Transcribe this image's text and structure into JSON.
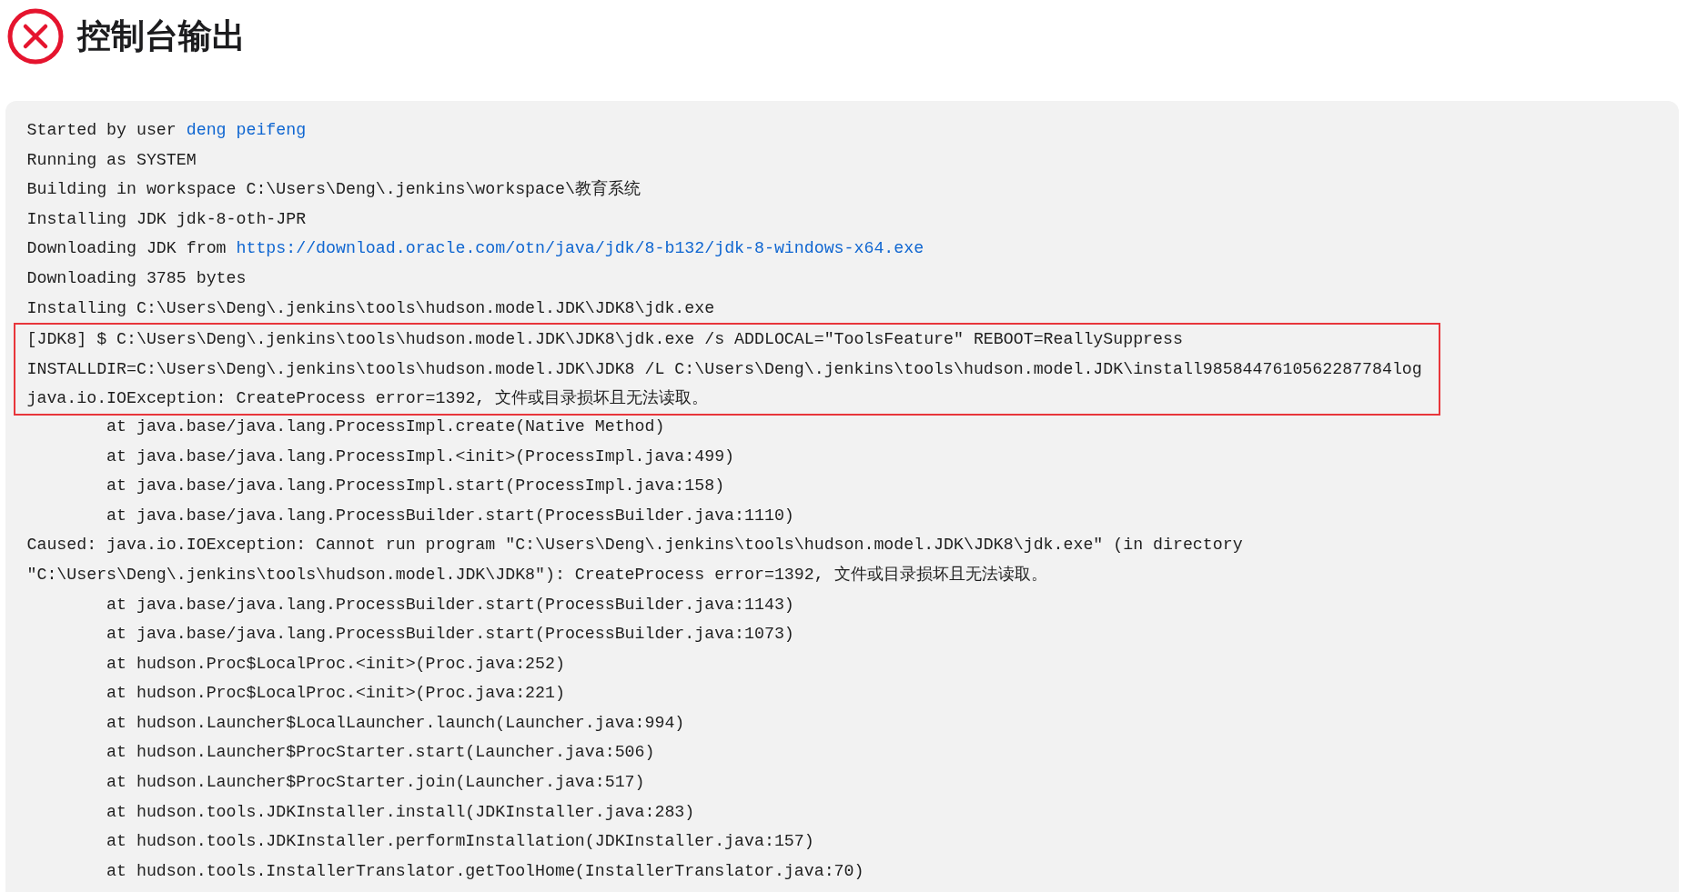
{
  "header": {
    "title": "控制台输出"
  },
  "log": {
    "sections": [
      {
        "highlighted": false,
        "lines": [
          {
            "kind": "message",
            "text": "Started by user ",
            "link": "deng peifeng"
          },
          {
            "kind": "message",
            "text": "Running as SYSTEM"
          },
          {
            "kind": "message",
            "text": "Building in workspace C:\\Users\\Deng\\.jenkins\\workspace\\教育系统"
          },
          {
            "kind": "message",
            "text": "Installing JDK jdk-8-oth-JPR"
          },
          {
            "kind": "message",
            "text": "Downloading JDK from ",
            "link": "https://download.oracle.com/otn/java/jdk/8-b132/jdk-8-windows-x64.exe"
          },
          {
            "kind": "message",
            "text": "Downloading 3785 bytes"
          },
          {
            "kind": "message",
            "text": "Installing C:\\Users\\Deng\\.jenkins\\tools\\hudson.model.JDK\\JDK8\\jdk.exe"
          }
        ]
      },
      {
        "highlighted": true,
        "lines": [
          {
            "kind": "message",
            "text": "[JDK8] $ C:\\Users\\Deng\\.jenkins\\tools\\hudson.model.JDK\\JDK8\\jdk.exe /s ADDLOCAL=\"ToolsFeature\" REBOOT=ReallySuppress"
          },
          {
            "kind": "message",
            "text": "INSTALLDIR=C:\\Users\\Deng\\.jenkins\\tools\\hudson.model.JDK\\JDK8 /L C:\\Users\\Deng\\.jenkins\\tools\\hudson.model.JDK\\install9858447610562287784log"
          },
          {
            "kind": "message",
            "text": "java.io.IOException: CreateProcess error=1392, 文件或目录损坏且无法读取。"
          }
        ]
      },
      {
        "highlighted": false,
        "lines": [
          {
            "kind": "frame",
            "text": "at java.base/java.lang.ProcessImpl.create(Native Method)"
          },
          {
            "kind": "frame",
            "text": "at java.base/java.lang.ProcessImpl.<init>(ProcessImpl.java:499)"
          },
          {
            "kind": "frame",
            "text": "at java.base/java.lang.ProcessImpl.start(ProcessImpl.java:158)"
          },
          {
            "kind": "frame",
            "text": "at java.base/java.lang.ProcessBuilder.start(ProcessBuilder.java:1110)"
          },
          {
            "kind": "message",
            "text": "Caused: java.io.IOException: Cannot run program \"C:\\Users\\Deng\\.jenkins\\tools\\hudson.model.JDK\\JDK8\\jdk.exe\" (in directory"
          },
          {
            "kind": "message",
            "text": "\"C:\\Users\\Deng\\.jenkins\\tools\\hudson.model.JDK\\JDK8\"): CreateProcess error=1392, 文件或目录损坏且无法读取。"
          },
          {
            "kind": "frame",
            "text": "at java.base/java.lang.ProcessBuilder.start(ProcessBuilder.java:1143)"
          },
          {
            "kind": "frame",
            "text": "at java.base/java.lang.ProcessBuilder.start(ProcessBuilder.java:1073)"
          },
          {
            "kind": "frame",
            "text": "at hudson.Proc$LocalProc.<init>(Proc.java:252)"
          },
          {
            "kind": "frame",
            "text": "at hudson.Proc$LocalProc.<init>(Proc.java:221)"
          },
          {
            "kind": "frame",
            "text": "at hudson.Launcher$LocalLauncher.launch(Launcher.java:994)"
          },
          {
            "kind": "frame",
            "text": "at hudson.Launcher$ProcStarter.start(Launcher.java:506)"
          },
          {
            "kind": "frame",
            "text": "at hudson.Launcher$ProcStarter.join(Launcher.java:517)"
          },
          {
            "kind": "frame",
            "text": "at hudson.tools.JDKInstaller.install(JDKInstaller.java:283)"
          },
          {
            "kind": "frame",
            "text": "at hudson.tools.JDKInstaller.performInstallation(JDKInstaller.java:157)"
          },
          {
            "kind": "frame",
            "text": "at hudson.tools.InstallerTranslator.getToolHome(InstallerTranslator.java:70)"
          }
        ]
      }
    ]
  }
}
